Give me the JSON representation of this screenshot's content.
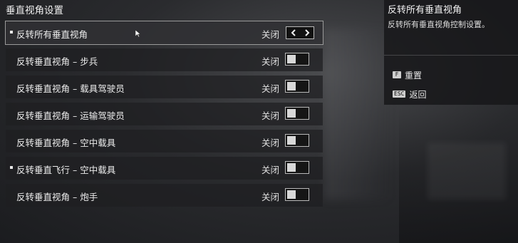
{
  "page": {
    "title": "垂直视角设置"
  },
  "settings": [
    {
      "label": "反转所有垂直视角",
      "value": "关闭",
      "selected": true,
      "control": "arrows",
      "bullet": true
    },
    {
      "label": "反转垂直视角 – 步兵",
      "value": "关闭",
      "control": "toggle"
    },
    {
      "label": "反转垂直视角 – 载具驾驶员",
      "value": "关闭",
      "control": "toggle"
    },
    {
      "label": "反转垂直视角 – 运输驾驶员",
      "value": "关闭",
      "control": "toggle"
    },
    {
      "label": "反转垂直视角 – 空中载具",
      "value": "关闭",
      "control": "toggle"
    },
    {
      "label": "反转垂直飞行 – 空中载具",
      "value": "关闭",
      "control": "toggle",
      "bullet": true
    },
    {
      "label": "反转垂直视角 – 炮手",
      "value": "关闭",
      "control": "toggle"
    }
  ],
  "info": {
    "title": "反转所有垂直视角",
    "description": "反转所有垂直视角控制设置。"
  },
  "hints": [
    {
      "key": "F",
      "label": "重置"
    },
    {
      "key": "ESC",
      "label": "返回"
    }
  ],
  "colors": {
    "selected_outline": "#9a9a9a",
    "row_bg": "#1e1e21",
    "text": "#ececec"
  }
}
